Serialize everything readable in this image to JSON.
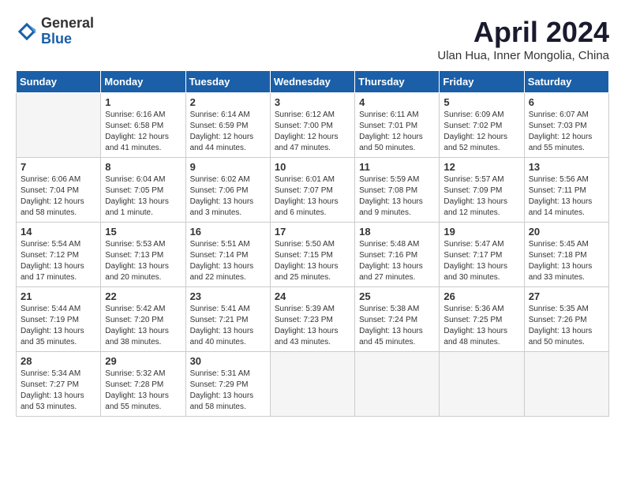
{
  "logo": {
    "general": "General",
    "blue": "Blue"
  },
  "title": "April 2024",
  "location": "Ulan Hua, Inner Mongolia, China",
  "days_header": [
    "Sunday",
    "Monday",
    "Tuesday",
    "Wednesday",
    "Thursday",
    "Friday",
    "Saturday"
  ],
  "weeks": [
    [
      {
        "day": "",
        "sunrise": "",
        "sunset": "",
        "daylight": "",
        "empty": true
      },
      {
        "day": "1",
        "sunrise": "Sunrise: 6:16 AM",
        "sunset": "Sunset: 6:58 PM",
        "daylight": "Daylight: 12 hours and 41 minutes."
      },
      {
        "day": "2",
        "sunrise": "Sunrise: 6:14 AM",
        "sunset": "Sunset: 6:59 PM",
        "daylight": "Daylight: 12 hours and 44 minutes."
      },
      {
        "day": "3",
        "sunrise": "Sunrise: 6:12 AM",
        "sunset": "Sunset: 7:00 PM",
        "daylight": "Daylight: 12 hours and 47 minutes."
      },
      {
        "day": "4",
        "sunrise": "Sunrise: 6:11 AM",
        "sunset": "Sunset: 7:01 PM",
        "daylight": "Daylight: 12 hours and 50 minutes."
      },
      {
        "day": "5",
        "sunrise": "Sunrise: 6:09 AM",
        "sunset": "Sunset: 7:02 PM",
        "daylight": "Daylight: 12 hours and 52 minutes."
      },
      {
        "day": "6",
        "sunrise": "Sunrise: 6:07 AM",
        "sunset": "Sunset: 7:03 PM",
        "daylight": "Daylight: 12 hours and 55 minutes."
      }
    ],
    [
      {
        "day": "7",
        "sunrise": "Sunrise: 6:06 AM",
        "sunset": "Sunset: 7:04 PM",
        "daylight": "Daylight: 12 hours and 58 minutes."
      },
      {
        "day": "8",
        "sunrise": "Sunrise: 6:04 AM",
        "sunset": "Sunset: 7:05 PM",
        "daylight": "Daylight: 13 hours and 1 minute."
      },
      {
        "day": "9",
        "sunrise": "Sunrise: 6:02 AM",
        "sunset": "Sunset: 7:06 PM",
        "daylight": "Daylight: 13 hours and 3 minutes."
      },
      {
        "day": "10",
        "sunrise": "Sunrise: 6:01 AM",
        "sunset": "Sunset: 7:07 PM",
        "daylight": "Daylight: 13 hours and 6 minutes."
      },
      {
        "day": "11",
        "sunrise": "Sunrise: 5:59 AM",
        "sunset": "Sunset: 7:08 PM",
        "daylight": "Daylight: 13 hours and 9 minutes."
      },
      {
        "day": "12",
        "sunrise": "Sunrise: 5:57 AM",
        "sunset": "Sunset: 7:09 PM",
        "daylight": "Daylight: 13 hours and 12 minutes."
      },
      {
        "day": "13",
        "sunrise": "Sunrise: 5:56 AM",
        "sunset": "Sunset: 7:11 PM",
        "daylight": "Daylight: 13 hours and 14 minutes."
      }
    ],
    [
      {
        "day": "14",
        "sunrise": "Sunrise: 5:54 AM",
        "sunset": "Sunset: 7:12 PM",
        "daylight": "Daylight: 13 hours and 17 minutes."
      },
      {
        "day": "15",
        "sunrise": "Sunrise: 5:53 AM",
        "sunset": "Sunset: 7:13 PM",
        "daylight": "Daylight: 13 hours and 20 minutes."
      },
      {
        "day": "16",
        "sunrise": "Sunrise: 5:51 AM",
        "sunset": "Sunset: 7:14 PM",
        "daylight": "Daylight: 13 hours and 22 minutes."
      },
      {
        "day": "17",
        "sunrise": "Sunrise: 5:50 AM",
        "sunset": "Sunset: 7:15 PM",
        "daylight": "Daylight: 13 hours and 25 minutes."
      },
      {
        "day": "18",
        "sunrise": "Sunrise: 5:48 AM",
        "sunset": "Sunset: 7:16 PM",
        "daylight": "Daylight: 13 hours and 27 minutes."
      },
      {
        "day": "19",
        "sunrise": "Sunrise: 5:47 AM",
        "sunset": "Sunset: 7:17 PM",
        "daylight": "Daylight: 13 hours and 30 minutes."
      },
      {
        "day": "20",
        "sunrise": "Sunrise: 5:45 AM",
        "sunset": "Sunset: 7:18 PM",
        "daylight": "Daylight: 13 hours and 33 minutes."
      }
    ],
    [
      {
        "day": "21",
        "sunrise": "Sunrise: 5:44 AM",
        "sunset": "Sunset: 7:19 PM",
        "daylight": "Daylight: 13 hours and 35 minutes."
      },
      {
        "day": "22",
        "sunrise": "Sunrise: 5:42 AM",
        "sunset": "Sunset: 7:20 PM",
        "daylight": "Daylight: 13 hours and 38 minutes."
      },
      {
        "day": "23",
        "sunrise": "Sunrise: 5:41 AM",
        "sunset": "Sunset: 7:21 PM",
        "daylight": "Daylight: 13 hours and 40 minutes."
      },
      {
        "day": "24",
        "sunrise": "Sunrise: 5:39 AM",
        "sunset": "Sunset: 7:23 PM",
        "daylight": "Daylight: 13 hours and 43 minutes."
      },
      {
        "day": "25",
        "sunrise": "Sunrise: 5:38 AM",
        "sunset": "Sunset: 7:24 PM",
        "daylight": "Daylight: 13 hours and 45 minutes."
      },
      {
        "day": "26",
        "sunrise": "Sunrise: 5:36 AM",
        "sunset": "Sunset: 7:25 PM",
        "daylight": "Daylight: 13 hours and 48 minutes."
      },
      {
        "day": "27",
        "sunrise": "Sunrise: 5:35 AM",
        "sunset": "Sunset: 7:26 PM",
        "daylight": "Daylight: 13 hours and 50 minutes."
      }
    ],
    [
      {
        "day": "28",
        "sunrise": "Sunrise: 5:34 AM",
        "sunset": "Sunset: 7:27 PM",
        "daylight": "Daylight: 13 hours and 53 minutes."
      },
      {
        "day": "29",
        "sunrise": "Sunrise: 5:32 AM",
        "sunset": "Sunset: 7:28 PM",
        "daylight": "Daylight: 13 hours and 55 minutes."
      },
      {
        "day": "30",
        "sunrise": "Sunrise: 5:31 AM",
        "sunset": "Sunset: 7:29 PM",
        "daylight": "Daylight: 13 hours and 58 minutes."
      },
      {
        "day": "",
        "sunrise": "",
        "sunset": "",
        "daylight": "",
        "empty": true
      },
      {
        "day": "",
        "sunrise": "",
        "sunset": "",
        "daylight": "",
        "empty": true
      },
      {
        "day": "",
        "sunrise": "",
        "sunset": "",
        "daylight": "",
        "empty": true
      },
      {
        "day": "",
        "sunrise": "",
        "sunset": "",
        "daylight": "",
        "empty": true
      }
    ]
  ]
}
